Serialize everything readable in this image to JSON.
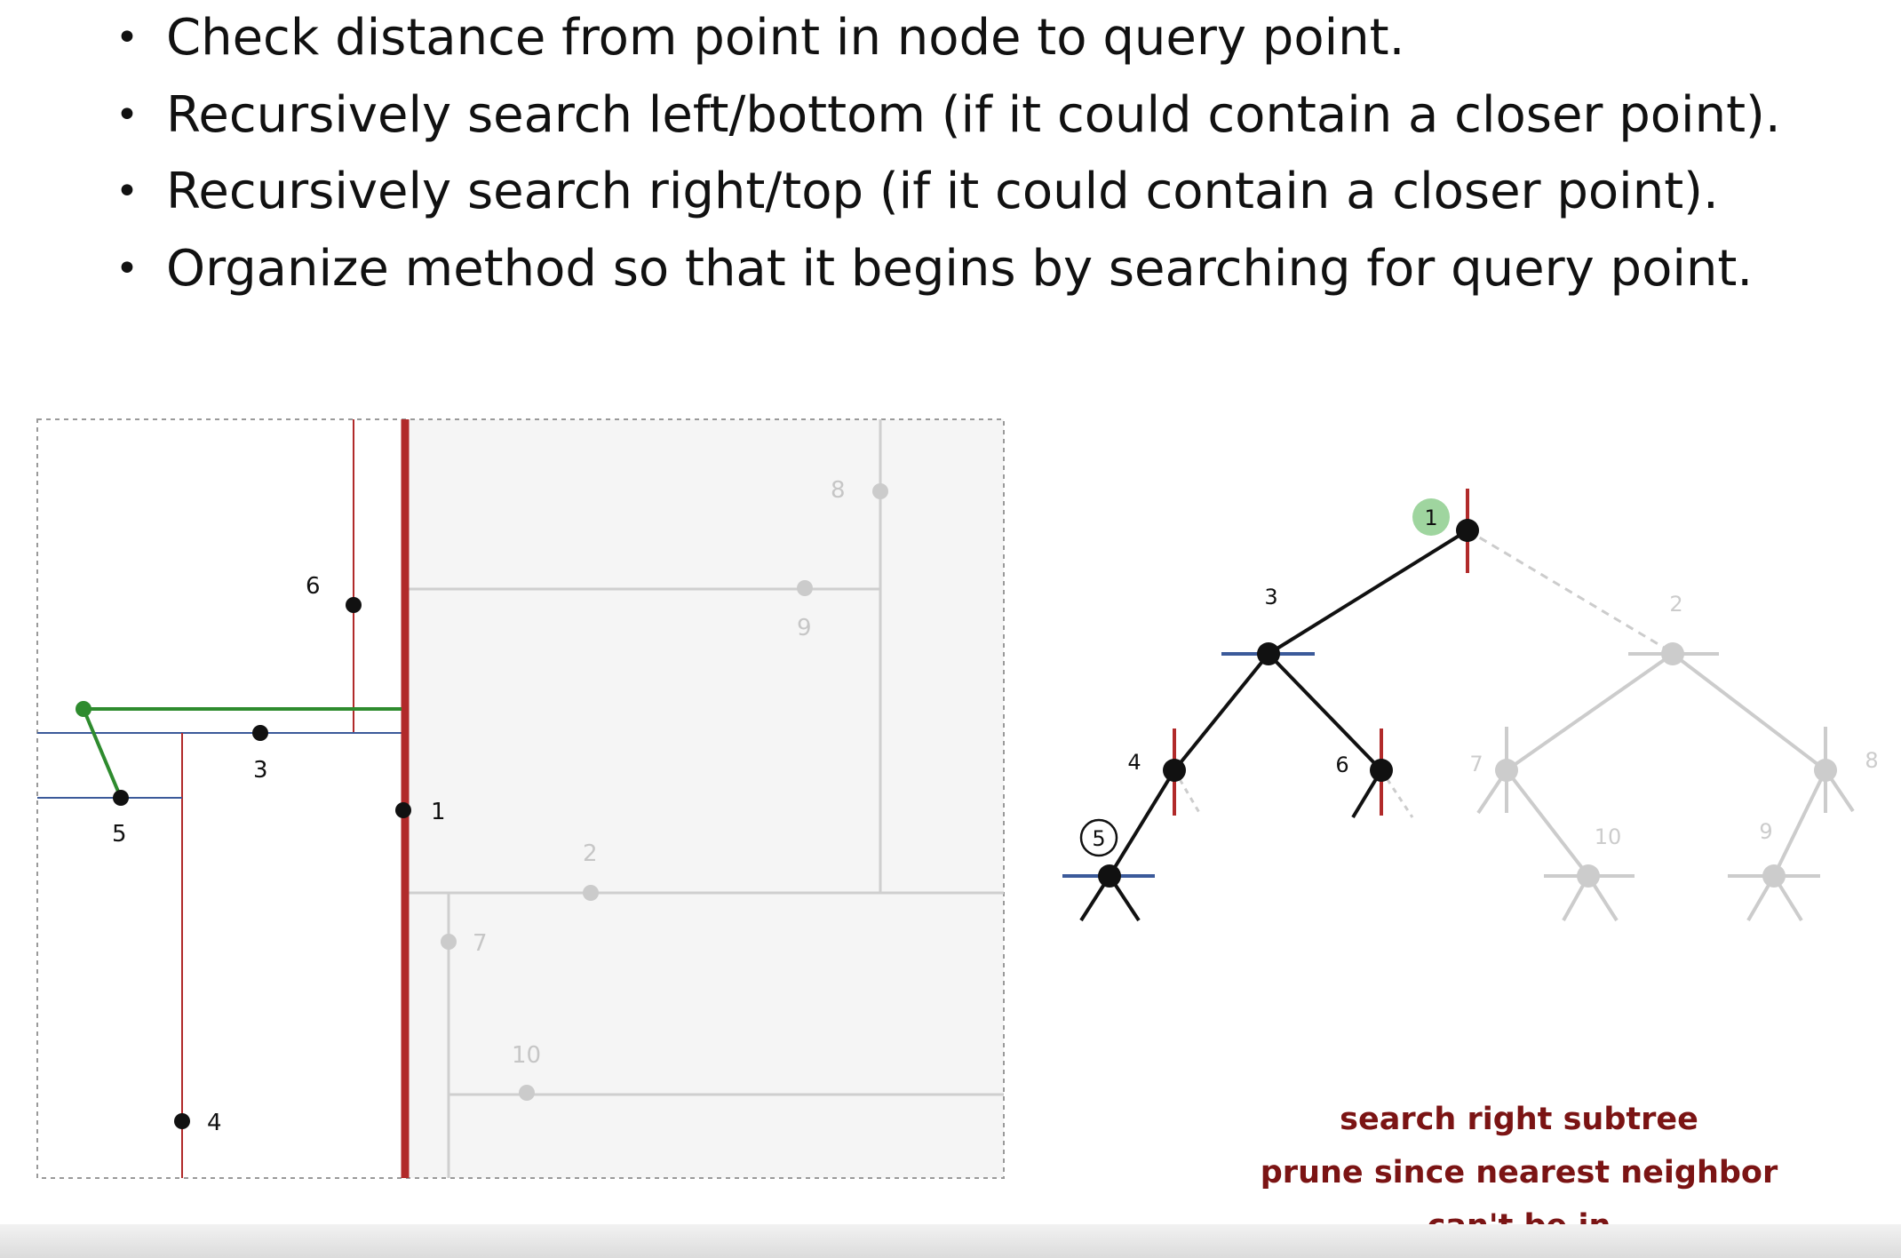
{
  "bullets": [
    "Check distance from point in node to query point.",
    "Recursively search left/bottom (if it could contain a closer point).",
    "Recursively search right/top (if it could contain a closer point).",
    "Organize method so that it begins by searching for query point."
  ],
  "plane": {
    "points": [
      {
        "id": "1",
        "label": "1",
        "active": true
      },
      {
        "id": "2",
        "label": "2",
        "active": false
      },
      {
        "id": "3",
        "label": "3",
        "active": true
      },
      {
        "id": "4",
        "label": "4",
        "active": true
      },
      {
        "id": "5",
        "label": "5",
        "active": true
      },
      {
        "id": "6",
        "label": "6",
        "active": true
      },
      {
        "id": "7",
        "label": "7",
        "active": false
      },
      {
        "id": "8",
        "label": "8",
        "active": false
      },
      {
        "id": "9",
        "label": "9",
        "active": false
      },
      {
        "id": "10",
        "label": "10",
        "active": false
      }
    ]
  },
  "tree": {
    "labels": {
      "n1": "1",
      "n3": "3",
      "n2": "2",
      "n4": "4",
      "n6": "6",
      "n5": "5",
      "n7": "7",
      "n8": "8",
      "n10": "10",
      "n9": "9"
    }
  },
  "captions": [
    "search right subtree",
    "prune since nearest neighbor",
    "can't be in"
  ],
  "colors": {
    "active_point": "#111111",
    "inactive_point": "#c6c6c6",
    "vertical_split": "#b12a2a",
    "horizontal_split": "#3b5a9a",
    "query_path": "#2e8b2e",
    "query_highlight": "#9fd59f",
    "caption": "#7b1414"
  }
}
